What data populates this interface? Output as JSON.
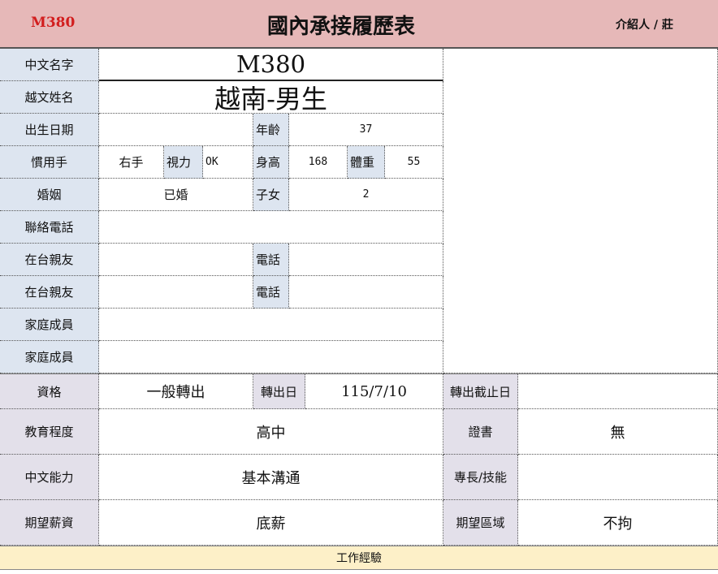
{
  "header": {
    "code": "M380",
    "title": "國內承接履歷表",
    "introducer": "介紹人 / 莊"
  },
  "labels": {
    "chinese_name": "中文名字",
    "vn_name": "越文姓名",
    "birth": "出生日期",
    "age": "年齡",
    "hand": "慣用手",
    "vision": "視力",
    "height": "身高",
    "weight": "體重",
    "marriage": "婚姻",
    "children": "子女",
    "phone": "聯絡電話",
    "relative1": "在台親友",
    "rel_phone1": "電話",
    "relative2": "在台親友",
    "rel_phone2": "電話",
    "family1": "家庭成員",
    "family2": "家庭成員",
    "qualification": "資格",
    "transfer_date": "轉出日",
    "transfer_deadline": "轉出截止日",
    "education": "教育程度",
    "certificate": "證書",
    "chinese_ability": "中文能力",
    "skills": "專長/技能",
    "salary": "期望薪資",
    "region": "期望區域",
    "work_experience": "工作經驗"
  },
  "values": {
    "chinese_name": "M380",
    "vn_name": "越南-男生",
    "birth": "",
    "age": "37",
    "hand": "右手",
    "vision": "OK",
    "height": "168",
    "weight": "55",
    "marriage": "已婚",
    "children": "2",
    "phone": "",
    "relative1": "",
    "rel_phone1": "",
    "relative2": "",
    "rel_phone2": "",
    "family1": "",
    "family2": "",
    "qualification": "一般轉出",
    "transfer_date": "115/7/10",
    "transfer_deadline": "",
    "education": "高中",
    "certificate": "無",
    "chinese_ability": "基本溝通",
    "skills": "",
    "salary": "底薪",
    "region": "不拘"
  },
  "colors": {
    "header_bg": "#e6b8b8",
    "code_red": "#d21e1e",
    "label_blue": "#dde5f0",
    "label_grey": "#e3e0ea",
    "work_bg": "#fdf0c8"
  }
}
